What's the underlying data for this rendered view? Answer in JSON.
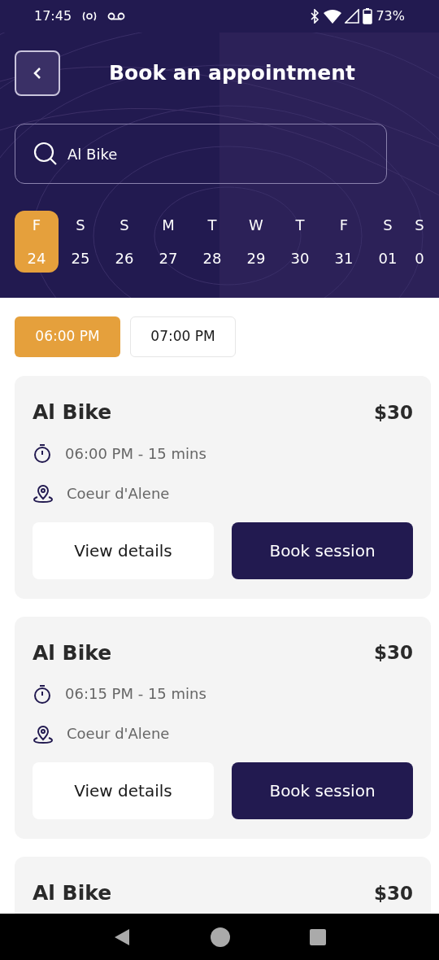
{
  "status_bar": {
    "time": "17:45",
    "battery": "73%"
  },
  "header": {
    "title": "Book an appointment"
  },
  "search": {
    "value": "Al Bike"
  },
  "days": [
    {
      "day": "F",
      "date": "24",
      "selected": true
    },
    {
      "day": "S",
      "date": "25",
      "selected": false
    },
    {
      "day": "S",
      "date": "26",
      "selected": false
    },
    {
      "day": "M",
      "date": "27",
      "selected": false
    },
    {
      "day": "T",
      "date": "28",
      "selected": false
    },
    {
      "day": "W",
      "date": "29",
      "selected": false
    },
    {
      "day": "T",
      "date": "30",
      "selected": false
    },
    {
      "day": "F",
      "date": "31",
      "selected": false
    },
    {
      "day": "S",
      "date": "01",
      "selected": false
    },
    {
      "day": "S",
      "date": "0",
      "selected": false
    }
  ],
  "times": [
    {
      "label": "06:00 PM",
      "selected": true
    },
    {
      "label": "07:00 PM",
      "selected": false
    }
  ],
  "sessions": [
    {
      "name": "Al Bike",
      "price": "$30",
      "time": "06:00 PM - 15 mins",
      "location": "Coeur d'Alene",
      "details_button": "View details",
      "book_button": "Book session"
    },
    {
      "name": "Al Bike",
      "price": "$30",
      "time": "06:15 PM - 15 mins",
      "location": "Coeur d'Alene",
      "details_button": "View details",
      "book_button": "Book session"
    },
    {
      "name": "Al Bike",
      "price": "$30"
    }
  ]
}
